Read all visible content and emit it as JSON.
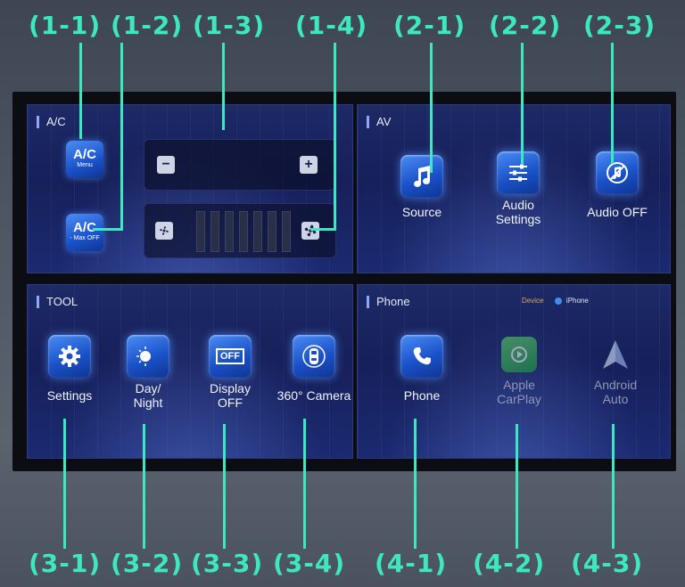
{
  "callouts": {
    "c1_1": "(1-1)",
    "c1_2": "(1-2)",
    "c1_3": "(1-3)",
    "c1_4": "(1-4)",
    "c2_1": "(2-1)",
    "c2_2": "(2-2)",
    "c2_3": "(2-3)",
    "c3_1": "(3-1)",
    "c3_2": "(3-2)",
    "c3_3": "(3-3)",
    "c3_4": "(3-4)",
    "c4_1": "(4-1)",
    "c4_2": "(4-2)",
    "c4_3": "(4-3)"
  },
  "ac": {
    "title": "A/C",
    "menu_main": "A/C",
    "menu_sub": "Menu",
    "maxoff_main": "A/C",
    "maxoff_sub": "- Max OFF",
    "temp_minus": "−",
    "temp_plus": "+",
    "fan_level": 0
  },
  "av": {
    "title": "AV",
    "source": "Source",
    "audio_settings_1": "Audio",
    "audio_settings_2": "Settings",
    "audio_off": "Audio  OFF"
  },
  "tool": {
    "title": "TOOL",
    "settings": "Settings",
    "daynight_1": "Day/",
    "daynight_2": "Night",
    "display_1": "Display",
    "display_2": "OFF",
    "display_icon_text": "OFF",
    "camera": "360° Camera"
  },
  "phone": {
    "title": "Phone",
    "device_label": "Device",
    "device_name": "iPhone",
    "phone_app": "Phone",
    "carplay_1": "Apple",
    "carplay_2": "CarPlay",
    "android_1": "Android",
    "android_2": "Auto"
  },
  "colors": {
    "callout": "#3de8c0",
    "panel": "#1b2670",
    "device_label": "#e0a35a"
  }
}
